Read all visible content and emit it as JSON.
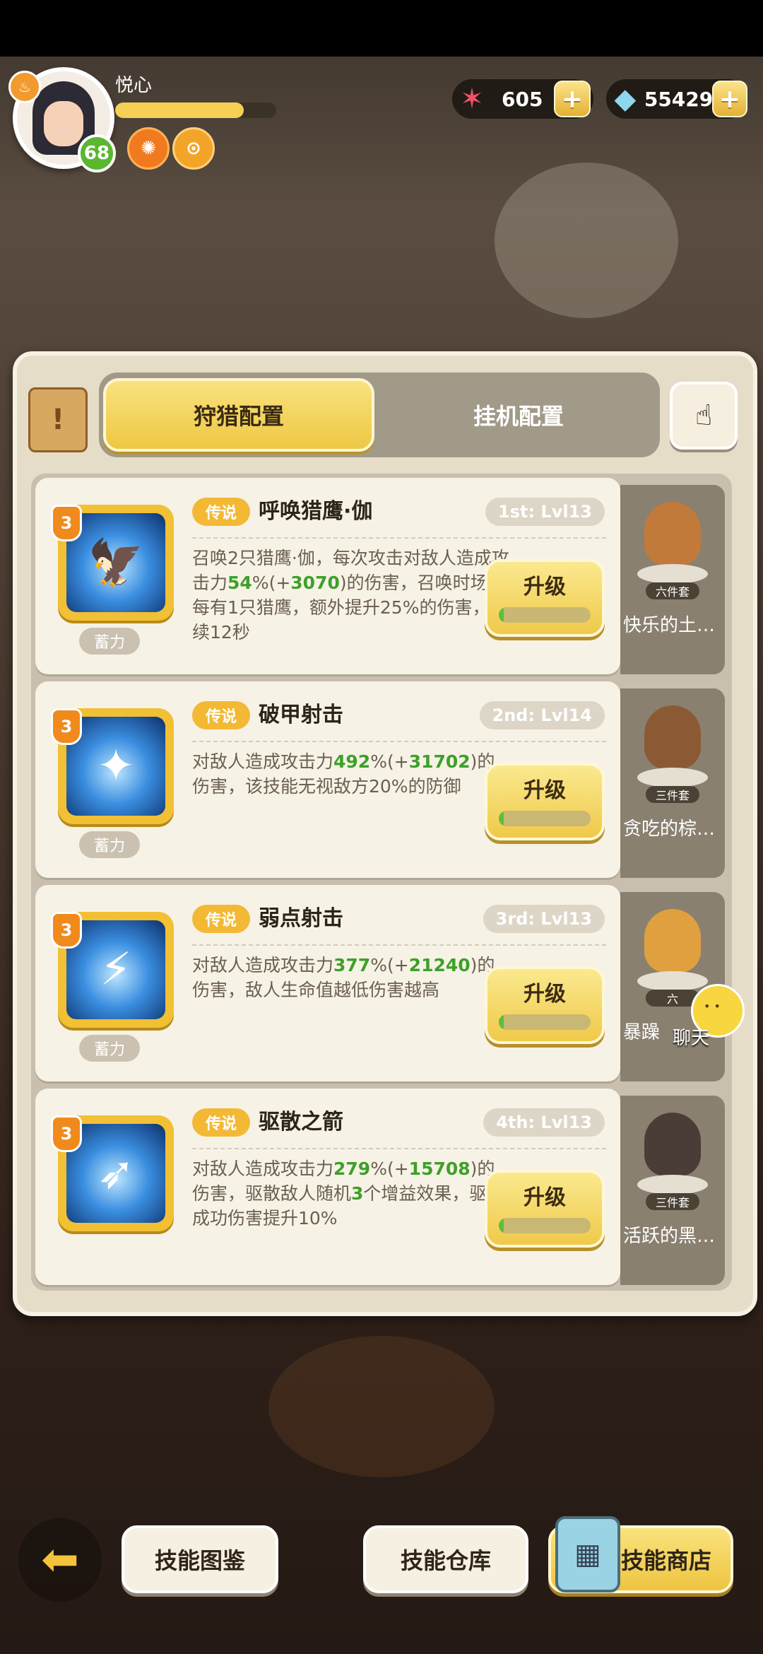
{
  "player": {
    "name": "悦心",
    "level": "68",
    "xp_progress": 0.8
  },
  "currency": {
    "starfish_value": "605",
    "crystal_value": "55429"
  },
  "tabs": {
    "active": "狩猎配置",
    "inactive": "挂机配置"
  },
  "skills": [
    {
      "tier": "传说",
      "name": "呼唤猎鹰·伽",
      "slot": "1st: Lvl13",
      "level_badge": "3",
      "charge_label": "蓄力",
      "desc_parts": [
        "召唤2只猎鹰·伽，每次攻击对敌人造成攻击力",
        "54",
        "%(+",
        "3070",
        ")的伤害，召唤时场上每有1只猎鹰，额外提升25%的伤害，持续12秒"
      ],
      "upgrade_label": "升级",
      "upgrade_progress": 0.05,
      "pet_name": "快乐的土…",
      "pet_set": "六件套",
      "icon": "eagle-icon"
    },
    {
      "tier": "传说",
      "name": "破甲射击",
      "slot": "2nd: Lvl14",
      "level_badge": "3",
      "charge_label": "蓄力",
      "desc_parts": [
        "对敌人造成攻击力",
        "492",
        "%(+",
        "31702",
        ")的伤害，该技能无视敌方20%的防御"
      ],
      "upgrade_label": "升级",
      "upgrade_progress": 0.05,
      "pet_name": "贪吃的棕…",
      "pet_set": "三件套",
      "icon": "armor-break-icon"
    },
    {
      "tier": "传说",
      "name": "弱点射击",
      "slot": "3rd: Lvl13",
      "level_badge": "3",
      "charge_label": "蓄力",
      "desc_parts": [
        "对敌人造成攻击力",
        "377",
        "%(+",
        "21240",
        ")的伤害，敌人生命值越低伤害越高"
      ],
      "upgrade_label": "升级",
      "upgrade_progress": 0.05,
      "pet_name": "暴躁",
      "pet_set": "六",
      "icon": "weak-point-icon"
    },
    {
      "tier": "传说",
      "name": "驱散之箭",
      "slot": "4th: Lvl13",
      "level_badge": "3",
      "charge_label": "",
      "desc_parts": [
        "对敌人造成攻击力",
        "279",
        "%(+",
        "15708",
        ")的伤害，驱散敌人随机",
        "3",
        "个增益效果，驱散成功伤害提升10%"
      ],
      "upgrade_label": "升级",
      "upgrade_progress": 0.05,
      "pet_name": "活跃的黑…",
      "pet_set": "三件套",
      "icon": "dispel-arrow-icon"
    }
  ],
  "chat": {
    "label": "聊天"
  },
  "bottom": {
    "catalog": "技能图鉴",
    "storage": "技能仓库",
    "shop": "技能商店"
  },
  "colors": {
    "accent_yellow": "#f0c94a",
    "highlight_green": "#3ea02a",
    "legend_orange": "#f3b934"
  }
}
